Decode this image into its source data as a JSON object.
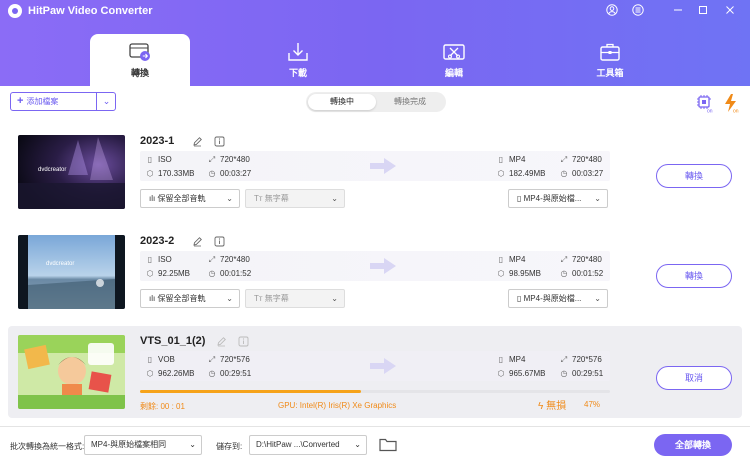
{
  "app": {
    "title": "HitPaw Video Converter"
  },
  "window_controls": [
    "account-icon",
    "settings-icon",
    "minimize-icon",
    "maximize-icon",
    "close-icon"
  ],
  "nav_tabs": [
    {
      "label": "轉換",
      "icon": "convert-icon",
      "active": true
    },
    {
      "label": "下載",
      "icon": "download-icon",
      "active": false
    },
    {
      "label": "編輯",
      "icon": "edit-icon",
      "active": false
    },
    {
      "label": "工具箱",
      "icon": "toolbox-icon",
      "active": false
    }
  ],
  "toolbar": {
    "add_file_label": "添加檔案",
    "segments": [
      "轉換中",
      "轉換完成"
    ],
    "active_segment": 0
  },
  "files": [
    {
      "name": "2023-1",
      "src": {
        "format": "ISO",
        "size": "170.33MB",
        "resolution": "720*480",
        "duration": "00:03:27"
      },
      "dst": {
        "format": "MP4",
        "size": "182.49MB",
        "resolution": "720*480",
        "duration": "00:03:27"
      },
      "audio": "保留全部音軌",
      "subtitle": "無字幕",
      "output_format": "MP4-與原始檔...",
      "action": "轉換"
    },
    {
      "name": "2023-2",
      "src": {
        "format": "ISO",
        "size": "92.25MB",
        "resolution": "720*480",
        "duration": "00:01:52"
      },
      "dst": {
        "format": "MP4",
        "size": "98.95MB",
        "resolution": "720*480",
        "duration": "00:01:52"
      },
      "audio": "保留全部音軌",
      "subtitle": "無字幕",
      "output_format": "MP4-與原始檔...",
      "action": "轉換"
    },
    {
      "name": "VTS_01_1(2)",
      "src": {
        "format": "VOB",
        "size": "962.26MB",
        "resolution": "720*576",
        "duration": "00:29:51"
      },
      "dst": {
        "format": "MP4",
        "size": "965.67MB",
        "resolution": "720*576",
        "duration": "00:29:51"
      },
      "remaining": "剩餘: 00 : 01",
      "gpu": "GPU: Intel(R) Iris(R) Xe Graphics",
      "lossless": "無損",
      "percent_text": "47%",
      "progress": 0.47,
      "action": "取消"
    }
  ],
  "bottom": {
    "batch_label": "批次轉換為統一格式:",
    "batch_value": "MP4-與原始檔案相同",
    "save_label": "儲存到:",
    "save_path": "D:\\HitPaw ...\\Converted",
    "convert_all": "全部轉換"
  },
  "colors": {
    "accent": "#7b66f2",
    "progress": "#f6a31a",
    "warning": "#f08a18"
  }
}
